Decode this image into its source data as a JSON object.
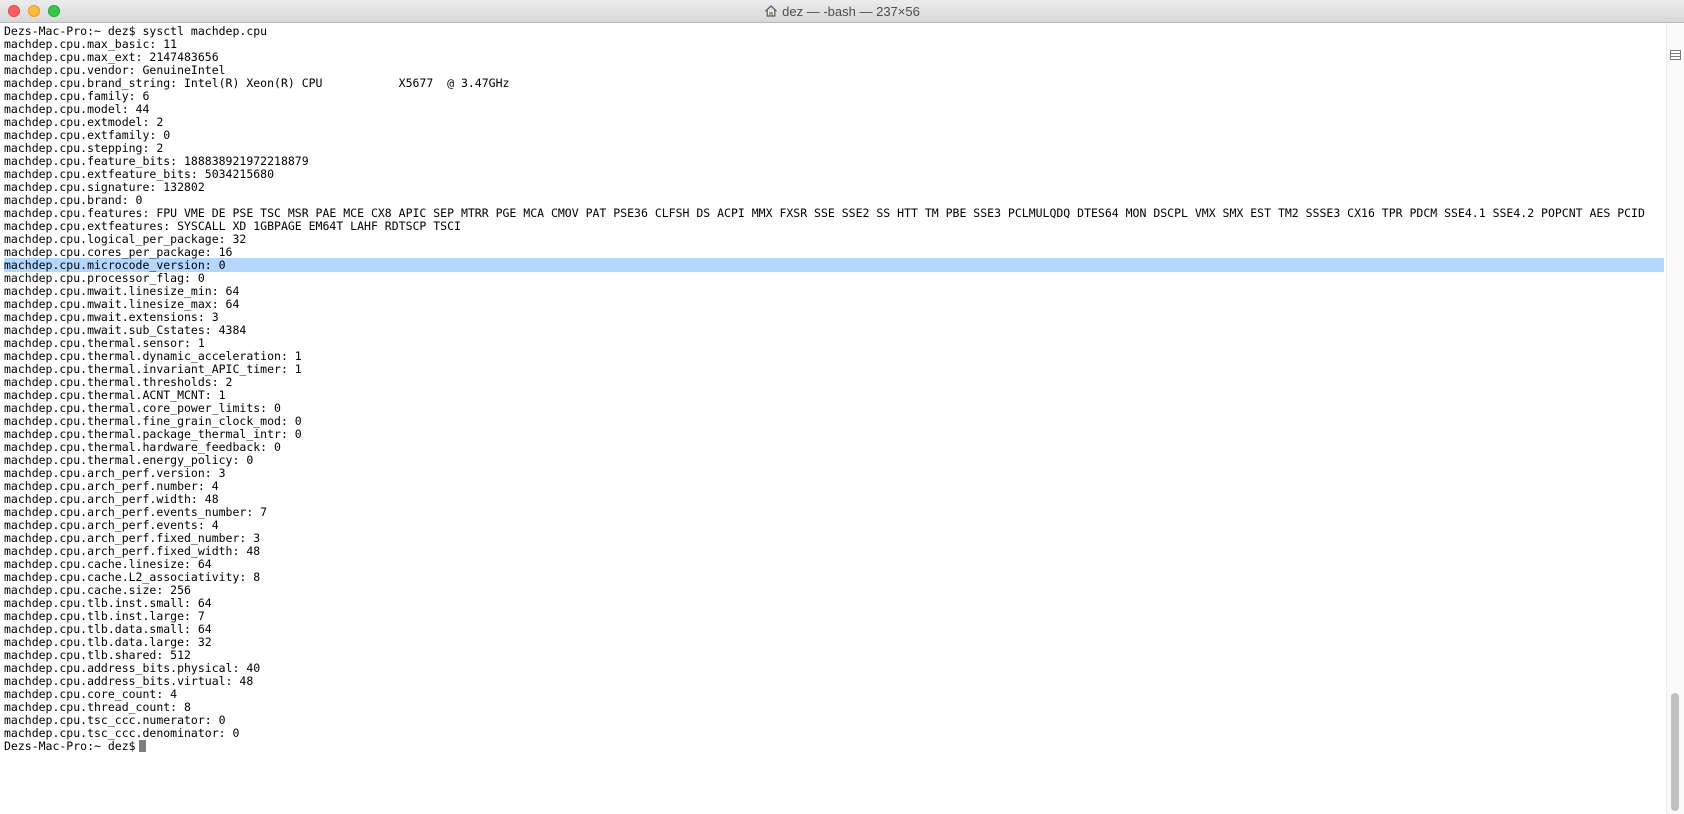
{
  "window": {
    "title": "dez — -bash — 237×56"
  },
  "terminal": {
    "lines": [
      "Dezs-Mac-Pro:~ dez$ sysctl machdep.cpu",
      "machdep.cpu.max_basic: 11",
      "machdep.cpu.max_ext: 2147483656",
      "machdep.cpu.vendor: GenuineIntel",
      "machdep.cpu.brand_string: Intel(R) Xeon(R) CPU           X5677  @ 3.47GHz",
      "machdep.cpu.family: 6",
      "machdep.cpu.model: 44",
      "machdep.cpu.extmodel: 2",
      "machdep.cpu.extfamily: 0",
      "machdep.cpu.stepping: 2",
      "machdep.cpu.feature_bits: 188838921972218879",
      "machdep.cpu.extfeature_bits: 5034215680",
      "machdep.cpu.signature: 132802",
      "machdep.cpu.brand: 0",
      "machdep.cpu.features: FPU VME DE PSE TSC MSR PAE MCE CX8 APIC SEP MTRR PGE MCA CMOV PAT PSE36 CLFSH DS ACPI MMX FXSR SSE SSE2 SS HTT TM PBE SSE3 PCLMULQDQ DTES64 MON DSCPL VMX SMX EST TM2 SSSE3 CX16 TPR PDCM SSE4.1 SSE4.2 POPCNT AES PCID",
      "machdep.cpu.extfeatures: SYSCALL XD 1GBPAGE EM64T LAHF RDTSCP TSCI",
      "machdep.cpu.logical_per_package: 32",
      "machdep.cpu.cores_per_package: 16",
      "machdep.cpu.microcode_version: 0",
      "machdep.cpu.processor_flag: 0",
      "machdep.cpu.mwait.linesize_min: 64",
      "machdep.cpu.mwait.linesize_max: 64",
      "machdep.cpu.mwait.extensions: 3",
      "machdep.cpu.mwait.sub_Cstates: 4384",
      "machdep.cpu.thermal.sensor: 1",
      "machdep.cpu.thermal.dynamic_acceleration: 1",
      "machdep.cpu.thermal.invariant_APIC_timer: 1",
      "machdep.cpu.thermal.thresholds: 2",
      "machdep.cpu.thermal.ACNT_MCNT: 1",
      "machdep.cpu.thermal.core_power_limits: 0",
      "machdep.cpu.thermal.fine_grain_clock_mod: 0",
      "machdep.cpu.thermal.package_thermal_intr: 0",
      "machdep.cpu.thermal.hardware_feedback: 0",
      "machdep.cpu.thermal.energy_policy: 0",
      "machdep.cpu.arch_perf.version: 3",
      "machdep.cpu.arch_perf.number: 4",
      "machdep.cpu.arch_perf.width: 48",
      "machdep.cpu.arch_perf.events_number: 7",
      "machdep.cpu.arch_perf.events: 4",
      "machdep.cpu.arch_perf.fixed_number: 3",
      "machdep.cpu.arch_perf.fixed_width: 48",
      "machdep.cpu.cache.linesize: 64",
      "machdep.cpu.cache.L2_associativity: 8",
      "machdep.cpu.cache.size: 256",
      "machdep.cpu.tlb.inst.small: 64",
      "machdep.cpu.tlb.inst.large: 7",
      "machdep.cpu.tlb.data.small: 64",
      "machdep.cpu.tlb.data.large: 32",
      "machdep.cpu.tlb.shared: 512",
      "machdep.cpu.address_bits.physical: 40",
      "machdep.cpu.address_bits.virtual: 48",
      "machdep.cpu.core_count: 4",
      "machdep.cpu.thread_count: 8",
      "machdep.cpu.tsc_ccc.numerator: 0",
      "machdep.cpu.tsc_ccc.denominator: 0"
    ],
    "highlighted_line": 18,
    "prompt": "Dezs-Mac-Pro:~ dez$"
  },
  "colors": {
    "selection": "#b3d7ff",
    "text": "#000000",
    "close": "#fc605c",
    "minimize": "#fdbc40",
    "maximize": "#34c84a"
  },
  "icons": {
    "title": "home-icon",
    "scrollbar": "split-pane-icon"
  }
}
